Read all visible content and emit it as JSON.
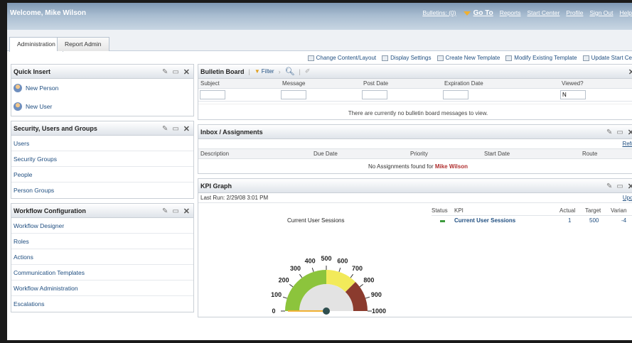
{
  "header": {
    "welcome": "Welcome, Mike Wilson",
    "nav": {
      "bulletins": "Bulletins: (0)",
      "goto": "Go To",
      "reports": "Reports",
      "start_center": "Start Center",
      "profile": "Profile",
      "sign_out": "Sign Out",
      "help": "Help"
    }
  },
  "tabs": [
    {
      "label": "Administration",
      "active": true
    },
    {
      "label": "Report Admin",
      "active": false
    }
  ],
  "toolbar": {
    "change_content": "Change Content/Layout",
    "display_settings": "Display Settings",
    "create_template": "Create New Template",
    "modify_template": "Modify Existing Template",
    "update_start": "Update Start Ce"
  },
  "quick_insert": {
    "title": "Quick Insert",
    "items": [
      "New Person",
      "New User"
    ]
  },
  "security": {
    "title": "Security, Users and Groups",
    "items": [
      "Users",
      "Security Groups",
      "People",
      "Person Groups"
    ]
  },
  "workflow": {
    "title": "Workflow Configuration",
    "items": [
      "Workflow Designer",
      "Roles",
      "Actions",
      "Communication Templates",
      "Workflow Administration",
      "Escalations"
    ]
  },
  "bulletin": {
    "title": "Bulletin Board",
    "filter": "Filter",
    "columns": [
      "Subject",
      "Message",
      "Post Date",
      "Expiration Date",
      "Viewed?"
    ],
    "viewed_value": "N",
    "empty_message": "There are currently no bulletin board messages to view."
  },
  "inbox": {
    "title": "Inbox / Assignments",
    "refresh": "Refre",
    "columns": [
      "Description",
      "Due Date",
      "Priority",
      "Start Date",
      "Route"
    ],
    "empty_prefix": "No Assignments found for",
    "user": "Mike Wilson"
  },
  "kpi": {
    "title": "KPI Graph",
    "last_run": "Last Run: 2/29/08 3:01 PM",
    "update": "Upda",
    "gauge_title": "Current User Sessions",
    "gauge_ticks": [
      "0",
      "100",
      "200",
      "300",
      "400",
      "500",
      "600",
      "700",
      "800",
      "900",
      "1000"
    ],
    "gauge_value": 1,
    "gauge_max": 1000,
    "table_headers": [
      "Status",
      "KPI",
      "Actual",
      "Target",
      "Varian"
    ],
    "row": {
      "kpi": "Current User Sessions",
      "actual": "1",
      "target": "500",
      "variance": "-4"
    }
  },
  "colors": {
    "accent": "#1f4e80",
    "header": "#8fa7bf",
    "danger": "#b03030"
  }
}
